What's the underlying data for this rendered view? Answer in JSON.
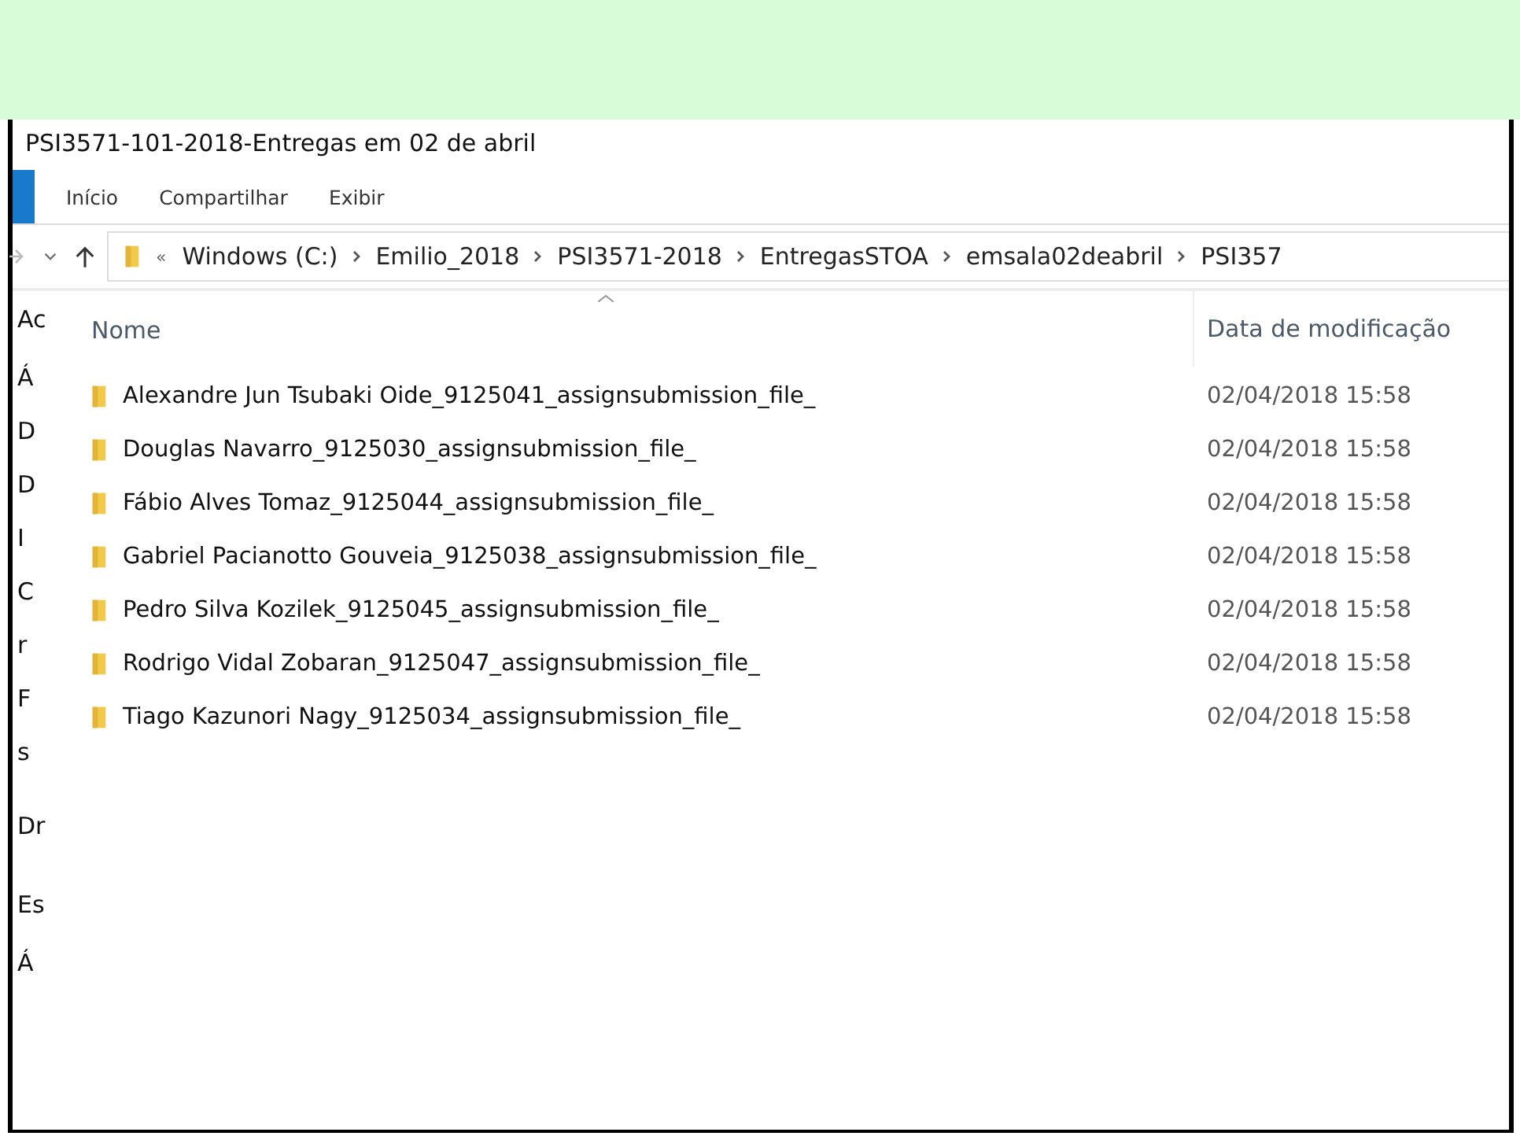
{
  "window": {
    "title": "PSI3571-101-2018-Entregas em 02 de abril"
  },
  "ribbon_tabs": [
    {
      "label": "Início"
    },
    {
      "label": "Compartilhar"
    },
    {
      "label": "Exibir"
    }
  ],
  "address_bar": {
    "separator": "«",
    "crumbs": [
      "Windows (C:)",
      "Emilio_2018",
      "PSI3571-2018",
      "EntregasSTOA",
      "emsala02deabril",
      "PSI357"
    ]
  },
  "sidebar": {
    "items": [
      "Ac",
      "Á",
      "D",
      "D",
      "I",
      "C",
      "r",
      "F",
      "s",
      "Dr",
      "Es",
      "Á"
    ]
  },
  "table": {
    "columns": [
      "Nome",
      "Data de modificação"
    ],
    "rows": [
      {
        "name": "Alexandre Jun Tsubaki Oide_9125041_assignsubmission_file_",
        "date": "02/04/2018 15:58"
      },
      {
        "name": "Douglas Navarro_9125030_assignsubmission_file_",
        "date": "02/04/2018 15:58"
      },
      {
        "name": "Fábio Alves Tomaz_9125044_assignsubmission_file_",
        "date": "02/04/2018 15:58"
      },
      {
        "name": "Gabriel Pacianotto Gouveia_9125038_assignsubmission_file_",
        "date": "02/04/2018 15:58"
      },
      {
        "name": "Pedro Silva Kozilek_9125045_assignsubmission_file_",
        "date": "02/04/2018 15:58"
      },
      {
        "name": "Rodrigo Vidal Zobaran_9125047_assignsubmission_file_",
        "date": "02/04/2018 15:58"
      },
      {
        "name": "Tiago Kazunori Nagy_9125034_assignsubmission_file_",
        "date": "02/04/2018 15:58"
      }
    ]
  }
}
